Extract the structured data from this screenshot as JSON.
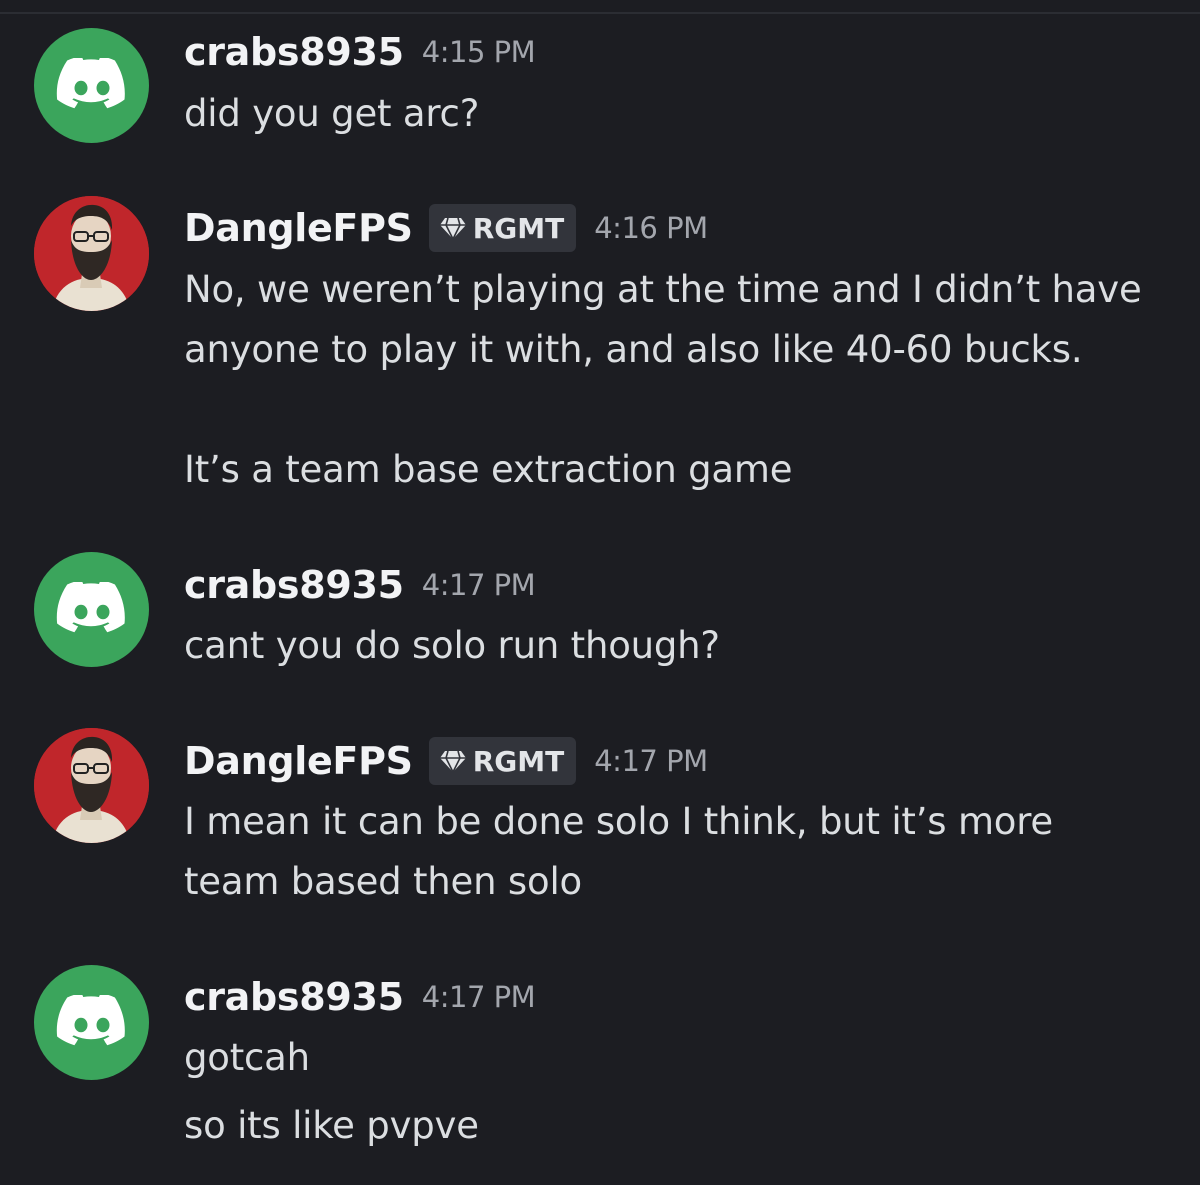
{
  "colors": {
    "background": "#1c1d22",
    "discord_avatar": "#3ba55c",
    "username": "#f2f3f5",
    "timestamp": "#a3a6ad",
    "message_text": "#dbdee1",
    "tag_background": "#32343b"
  },
  "messages": [
    {
      "author": "crabs8935",
      "avatar": "discord-logo-icon",
      "timestamp": "4:15 PM",
      "lines": [
        "did you get arc?"
      ]
    },
    {
      "author": "DangleFPS",
      "avatar": "user-photo",
      "tag": "RGMT",
      "tag_icon": "gem-icon",
      "timestamp": "4:16 PM",
      "lines": [
        "No, we weren’t playing at the time and I didn’t have",
        "anyone to play it with, and also like 40-60 bucks.",
        "It’s a team base extraction game"
      ]
    },
    {
      "author": "crabs8935",
      "avatar": "discord-logo-icon",
      "timestamp": "4:17 PM",
      "lines": [
        "cant you do solo run though?"
      ]
    },
    {
      "author": "DangleFPS",
      "avatar": "user-photo",
      "tag": "RGMT",
      "tag_icon": "gem-icon",
      "timestamp": "4:17 PM",
      "lines": [
        "I mean it can be done solo I think, but it’s more",
        "team based then solo"
      ]
    },
    {
      "author": "crabs8935",
      "avatar": "discord-logo-icon",
      "timestamp": "4:17 PM",
      "lines": [
        "gotcah",
        "so its like pvpve"
      ]
    }
  ]
}
